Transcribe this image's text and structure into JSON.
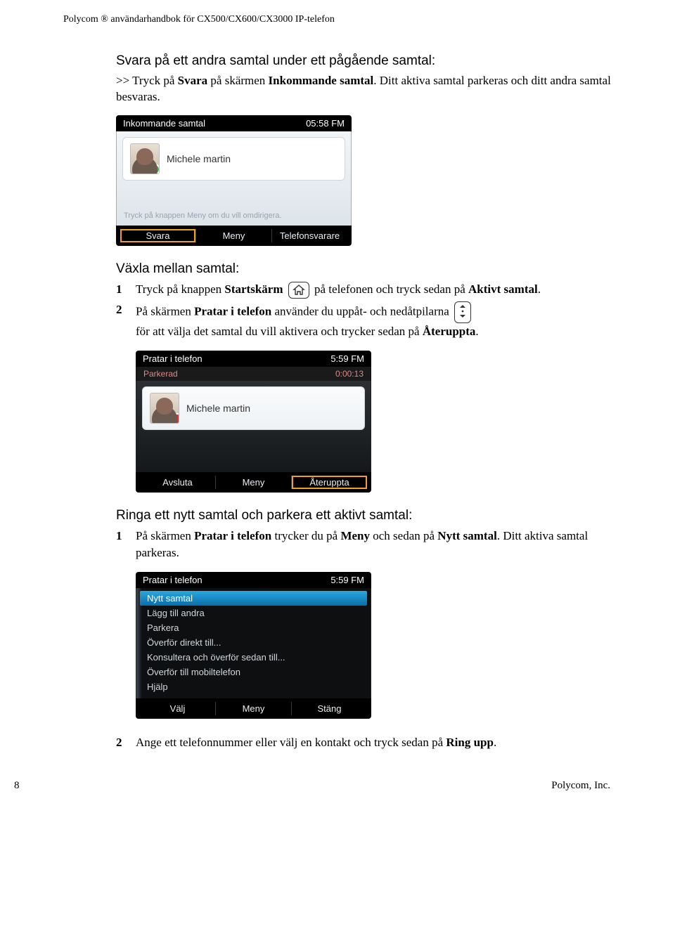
{
  "header": "Polycom ® användarhandbok för CX500/CX600/CX3000 IP-telefon",
  "section1": {
    "heading": "Svara på ett andra samtal under ett pågående samtal:",
    "para_before": ">> Tryck på ",
    "para_bold1": "Svara",
    "para_mid1": " på skärmen ",
    "para_bold2": "Inkommande samtal",
    "para_after": ". Ditt aktiva samtal parkeras och ditt andra samtal besvaras."
  },
  "shot1": {
    "title": "Inkommande samtal",
    "time": "05:58 FM",
    "name": "Michele martin",
    "hint": "Tryck på knappen Meny om du vill omdirigera.",
    "btn1": "Svara",
    "btn2": "Meny",
    "btn3": "Telefonsvarare"
  },
  "section2": {
    "heading": "Växla mellan samtal:",
    "s1_num": "1",
    "s1_a": "Tryck på knappen ",
    "s1_b": "Startskärm",
    "s1_c": " på telefonen och tryck sedan på ",
    "s1_d": "Aktivt samtal",
    "s1_e": ".",
    "s2_num": "2",
    "s2_a": "På skärmen ",
    "s2_b": "Pratar i telefon",
    "s2_c": " använder du uppåt- och nedåtpilarna ",
    "s2_d": "för att välja det samtal du vill aktivera och trycker sedan på ",
    "s2_e": "Återuppta",
    "s2_f": "."
  },
  "shot2": {
    "title": "Pratar i telefon",
    "time": "5:59 FM",
    "sub_left": "Parkerad",
    "sub_right": "0:00:13",
    "name": "Michele martin",
    "btn1": "Avsluta",
    "btn2": "Meny",
    "btn3": "Återuppta"
  },
  "section3": {
    "heading": "Ringa ett nytt samtal och parkera ett aktivt samtal:",
    "s1_num": "1",
    "s1_a": "På skärmen ",
    "s1_b": "Pratar i telefon",
    "s1_c": " trycker du på ",
    "s1_d": "Meny",
    "s1_e": " och sedan på ",
    "s1_f": "Nytt samtal",
    "s1_g": ". Ditt aktiva samtal parkeras."
  },
  "shot3": {
    "title": "Pratar i telefon",
    "time": "5:59 FM",
    "items": [
      "Nytt samtal",
      "Lägg till andra",
      "Parkera",
      "Överför direkt till...",
      "Konsultera och överför sedan till...",
      "Överför till mobiltelefon",
      "Hjälp"
    ],
    "btn1": "Välj",
    "btn2": "Meny",
    "btn3": "Stäng"
  },
  "section3b": {
    "s2_num": "2",
    "s2_a": "Ange ett telefonnummer eller välj en kontakt och tryck sedan på ",
    "s2_b": "Ring upp",
    "s2_c": "."
  },
  "footer": {
    "page": "8",
    "company": "Polycom, Inc."
  }
}
